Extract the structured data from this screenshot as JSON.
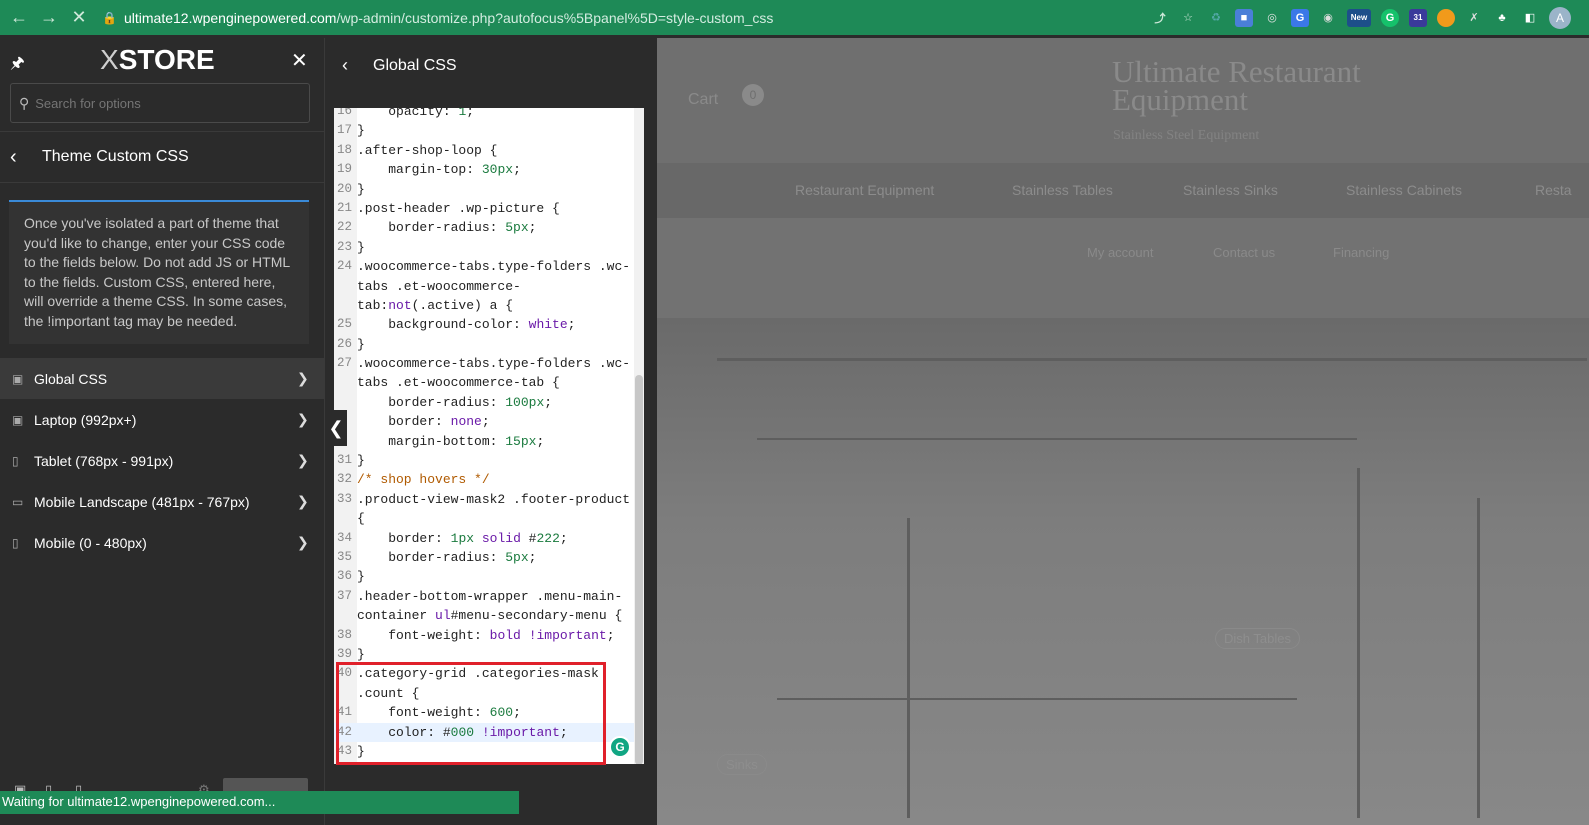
{
  "browser": {
    "url_host": "ultimate12.wpenginepowered.com",
    "url_path": "/wp-admin/customize.php?autofocus%5Bpanel%5D=style-custom_css",
    "ext_new_label": "New",
    "ext_calendar_label": "31",
    "avatar_letter": "A",
    "status_text": "Waiting for ultimate12.wpenginepowered.com..."
  },
  "left_panel": {
    "logo_prefix": "X",
    "logo_text": "STORE",
    "search_placeholder": "Search for options",
    "section_title": "Theme Custom CSS",
    "description": "Once you've isolated a part of theme that you'd like to change, enter your CSS code to the fields below. Do not add JS or HTML to the fields. Custom CSS, entered here, will override a theme CSS. In some cases, the !important tag may be needed.",
    "menu": [
      {
        "label": "Global CSS",
        "icon": "desktop-icon",
        "active": true
      },
      {
        "label": "Laptop (992px+)",
        "icon": "laptop-icon",
        "active": false
      },
      {
        "label": "Tablet (768px - 991px)",
        "icon": "tablet-icon",
        "active": false
      },
      {
        "label": "Mobile Landscape (481px - 767px)",
        "icon": "mobile-landscape-icon",
        "active": false
      },
      {
        "label": "Mobile (0 - 480px)",
        "icon": "mobile-icon",
        "active": false
      }
    ],
    "publish_label": "PUBLISHED"
  },
  "mid_panel": {
    "title": "Global CSS",
    "code_lines": [
      {
        "n": "16",
        "t": "    opacity: 1;"
      },
      {
        "n": "17",
        "t": "}"
      },
      {
        "n": "18",
        "t": ".after-shop-loop {"
      },
      {
        "n": "19",
        "t": "    margin-top: 30px;"
      },
      {
        "n": "20",
        "t": "}"
      },
      {
        "n": "21",
        "t": ".post-header .wp-picture {"
      },
      {
        "n": "22",
        "t": "    border-radius: 5px;"
      },
      {
        "n": "23",
        "t": "}"
      },
      {
        "n": "24",
        "t": ".woocommerce-tabs.type-folders .wc-"
      },
      {
        "n": "",
        "t": "tabs .et-woocommerce-"
      },
      {
        "n": "",
        "t": "tab:not(.active) a {"
      },
      {
        "n": "25",
        "t": "    background-color: white;"
      },
      {
        "n": "26",
        "t": "}"
      },
      {
        "n": "27",
        "t": ".woocommerce-tabs.type-folders .wc-"
      },
      {
        "n": "",
        "t": "tabs .et-woocommerce-tab {"
      },
      {
        "n": "",
        "t": "    border-radius: 100px;"
      },
      {
        "n": "",
        "t": "    border: none;"
      },
      {
        "n": "",
        "t": "    margin-bottom: 15px;"
      },
      {
        "n": "31",
        "t": "}"
      },
      {
        "n": "32",
        "t": "/* shop hovers */"
      },
      {
        "n": "33",
        "t": ".product-view-mask2 .footer-product"
      },
      {
        "n": "",
        "t": "{"
      },
      {
        "n": "34",
        "t": "    border: 1px solid #222;"
      },
      {
        "n": "35",
        "t": "    border-radius: 5px;"
      },
      {
        "n": "36",
        "t": "}"
      },
      {
        "n": "37",
        "t": ".header-bottom-wrapper .menu-main-"
      },
      {
        "n": "",
        "t": "container ul#menu-secondary-menu {"
      },
      {
        "n": "38",
        "t": "    font-weight: bold !important;"
      },
      {
        "n": "39",
        "t": "}"
      },
      {
        "n": "40",
        "t": ".category-grid .categories-mask"
      },
      {
        "n": "",
        "t": ".count {"
      },
      {
        "n": "41",
        "t": "    font-weight: 600;"
      },
      {
        "n": "42",
        "t": "    color: #000 !important;"
      },
      {
        "n": "43",
        "t": "}"
      }
    ]
  },
  "preview": {
    "cart_label": "Cart",
    "cart_count": "0",
    "logo_line1": "Ultimate Restaurant",
    "logo_line2": "Equipment",
    "logo_tagline": "Stainless Steel Equipment",
    "nav": [
      "Restaurant Equipment",
      "Stainless Tables",
      "Stainless Sinks",
      "Stainless Cabinets",
      "Resta"
    ],
    "subnav": [
      "My account",
      "Contact us",
      "Financing"
    ],
    "hero_buttons": [
      "Dish Tables",
      "Sinks"
    ]
  }
}
